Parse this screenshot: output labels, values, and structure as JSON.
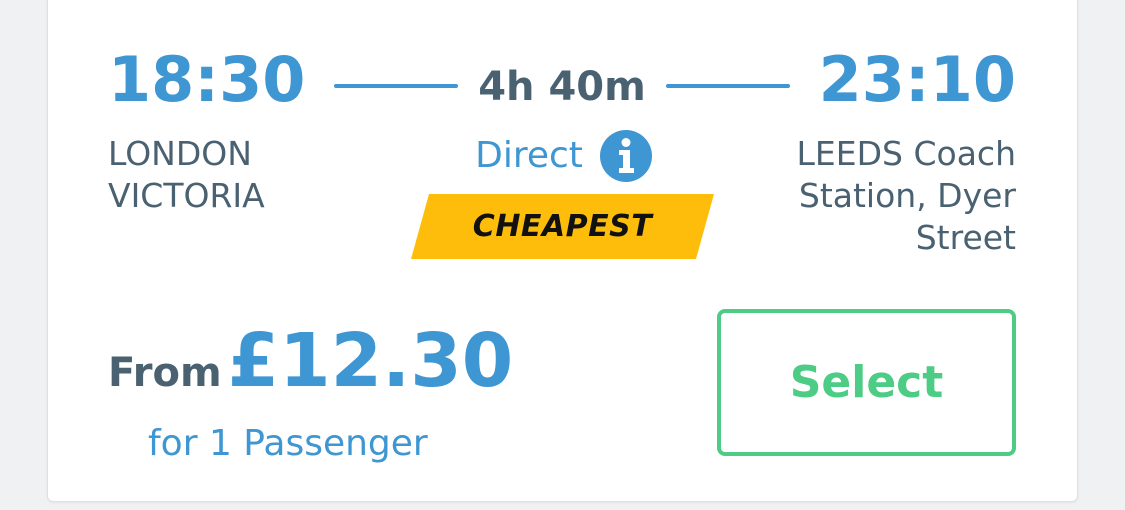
{
  "colors": {
    "accent_blue": "#3e96d2",
    "slate_text": "#4a6172",
    "badge_yellow": "#fdbd0a",
    "select_green": "#4ccc84"
  },
  "journey": {
    "departure": {
      "time": "18:30",
      "station_line1": "LONDON",
      "station_line2": "VICTORIA"
    },
    "arrival": {
      "time": "23:10",
      "station_line1": "LEEDS Coach",
      "station_line2": "Station, Dyer",
      "station_line3": "Street"
    },
    "duration": "4h 40m",
    "route_type": "Direct",
    "info_icon": "info-icon",
    "badge": "CHEAPEST"
  },
  "pricing": {
    "from_label": "From",
    "price": "£12.30",
    "passengers": "for 1 Passenger"
  },
  "actions": {
    "select_label": "Select"
  }
}
